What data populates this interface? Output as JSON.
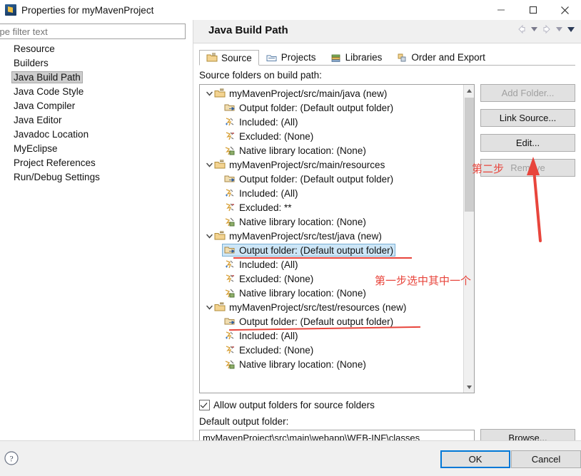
{
  "window": {
    "title": "Properties for myMavenProject",
    "icon": "eclipse-properties-icon",
    "controls": {
      "minimize": "—",
      "maximize": "☐",
      "close": "✕"
    }
  },
  "filter": {
    "value": "",
    "placeholder": "ype filter text"
  },
  "sidebar": {
    "items": [
      {
        "label": "Resource",
        "selected": false
      },
      {
        "label": "Builders",
        "selected": false
      },
      {
        "label": "Java Build Path",
        "selected": true
      },
      {
        "label": "Java Code Style",
        "selected": false
      },
      {
        "label": "Java Compiler",
        "selected": false
      },
      {
        "label": "Java Editor",
        "selected": false
      },
      {
        "label": "Javadoc Location",
        "selected": false
      },
      {
        "label": "MyEclipse",
        "selected": false
      },
      {
        "label": "Project References",
        "selected": false
      },
      {
        "label": "Run/Debug Settings",
        "selected": false
      }
    ]
  },
  "page": {
    "title": "Java Build Path",
    "nav": {
      "back": "back-arrow",
      "back_menu": "back-dropdown",
      "forward": "forward-arrow",
      "forward_menu": "forward-dropdown",
      "view_menu": "view-menu-chevron"
    }
  },
  "tabs": [
    {
      "label": "Source",
      "icon": "source-folder-icon",
      "active": true
    },
    {
      "label": "Projects",
      "icon": "projects-icon",
      "active": false
    },
    {
      "label": "Libraries",
      "icon": "libraries-icon",
      "active": false
    },
    {
      "label": "Order and Export",
      "icon": "order-export-icon",
      "active": false
    }
  ],
  "source_tab": {
    "section_label": "Source folders on build path:",
    "tree": [
      {
        "root": "myMavenProject/src/main/java (new)",
        "icon": "source-folder-icon",
        "expanded": true,
        "children": [
          {
            "label": "Output folder: (Default output folder)",
            "icon": "output-folder-icon",
            "selected": false
          },
          {
            "label": "Included: (All)",
            "icon": "included-icon",
            "selected": false
          },
          {
            "label": "Excluded: (None)",
            "icon": "excluded-icon",
            "selected": false
          },
          {
            "label": "Native library location: (None)",
            "icon": "native-library-icon",
            "selected": false
          }
        ]
      },
      {
        "root": "myMavenProject/src/main/resources",
        "icon": "source-folder-icon",
        "expanded": true,
        "children": [
          {
            "label": "Output folder: (Default output folder)",
            "icon": "output-folder-icon",
            "selected": false
          },
          {
            "label": "Included: (All)",
            "icon": "included-icon",
            "selected": false
          },
          {
            "label": "Excluded: **",
            "icon": "excluded-icon",
            "selected": false
          },
          {
            "label": "Native library location: (None)",
            "icon": "native-library-icon",
            "selected": false
          }
        ]
      },
      {
        "root": "myMavenProject/src/test/java (new)",
        "icon": "source-folder-icon",
        "expanded": true,
        "children": [
          {
            "label": "Output folder: (Default output folder)",
            "icon": "output-folder-icon",
            "selected": true
          },
          {
            "label": "Included: (All)",
            "icon": "included-icon",
            "selected": false
          },
          {
            "label": "Excluded: (None)",
            "icon": "excluded-icon",
            "selected": false
          },
          {
            "label": "Native library location: (None)",
            "icon": "native-library-icon",
            "selected": false
          }
        ]
      },
      {
        "root": "myMavenProject/src/test/resources (new)",
        "icon": "source-folder-icon",
        "expanded": true,
        "children": [
          {
            "label": "Output folder: (Default output folder)",
            "icon": "output-folder-icon",
            "selected": false
          },
          {
            "label": "Included: (All)",
            "icon": "included-icon",
            "selected": false
          },
          {
            "label": "Excluded: (None)",
            "icon": "excluded-icon",
            "selected": false
          },
          {
            "label": "Native library location: (None)",
            "icon": "native-library-icon",
            "selected": false
          }
        ]
      }
    ],
    "buttons": [
      {
        "label": "Add Folder...",
        "enabled": false
      },
      {
        "label": "Link Source...",
        "enabled": true
      },
      {
        "label": "Edit...",
        "enabled": true
      },
      {
        "label": "Remove",
        "enabled": false
      }
    ],
    "allow_output_folders": {
      "label": "Allow output folders for source folders",
      "checked": true
    },
    "default_output_folder": {
      "label": "Default output folder:",
      "value": "myMavenProject\\src\\main\\webapp\\WEB-INF\\classes"
    },
    "browse_button": "Browse..."
  },
  "footer": {
    "help_icon": "help-question-icon",
    "ok": "OK",
    "cancel": "Cancel"
  },
  "annotations": [
    {
      "text": "第二步",
      "note": "step-two-label"
    },
    {
      "text": "第一步选中其中一个",
      "note": "step-one-label"
    }
  ],
  "colors": {
    "accent": "#0078d7",
    "selection": "#cde6f7",
    "annotation": "#e8453c",
    "chrome": "#f0f0f0"
  }
}
